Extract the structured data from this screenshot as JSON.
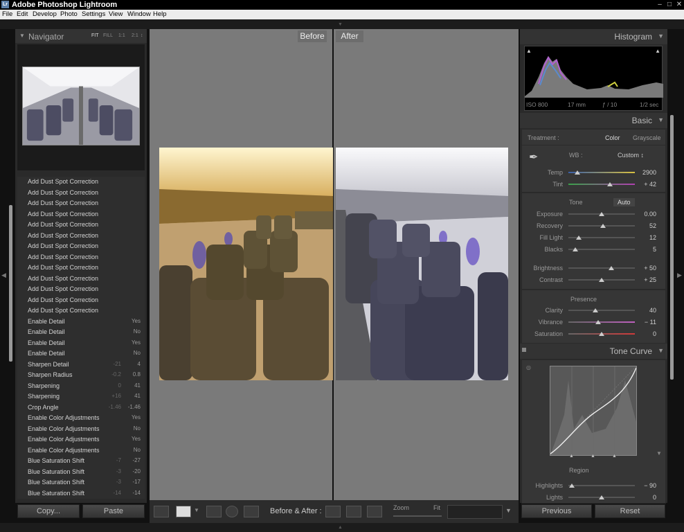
{
  "window": {
    "app_title": "Adobe Photoshop Lightroom",
    "logo": "Lr"
  },
  "menu": [
    "File",
    "Edit",
    "Develop",
    "Photo",
    "Settings",
    "View",
    "Window",
    "Help"
  ],
  "navigator": {
    "title": "Navigator",
    "zoom_options": [
      "FIT",
      "FILL",
      "1:1",
      "2:1"
    ]
  },
  "history": [
    {
      "label": "Add Dust Spot Correction",
      "before": "",
      "after": ""
    },
    {
      "label": "Add Dust Spot Correction",
      "before": "",
      "after": ""
    },
    {
      "label": "Add Dust Spot Correction",
      "before": "",
      "after": ""
    },
    {
      "label": "Add Dust Spot Correction",
      "before": "",
      "after": ""
    },
    {
      "label": "Add Dust Spot Correction",
      "before": "",
      "after": ""
    },
    {
      "label": "Add Dust Spot Correction",
      "before": "",
      "after": ""
    },
    {
      "label": "Add Dust Spot Correction",
      "before": "",
      "after": ""
    },
    {
      "label": "Add Dust Spot Correction",
      "before": "",
      "after": ""
    },
    {
      "label": "Add Dust Spot Correction",
      "before": "",
      "after": ""
    },
    {
      "label": "Add Dust Spot Correction",
      "before": "",
      "after": ""
    },
    {
      "label": "Add Dust Spot Correction",
      "before": "",
      "after": ""
    },
    {
      "label": "Add Dust Spot Correction",
      "before": "",
      "after": ""
    },
    {
      "label": "Add Dust Spot Correction",
      "before": "",
      "after": ""
    },
    {
      "label": "Enable Detail",
      "before": "",
      "after": "Yes"
    },
    {
      "label": "Enable Detail",
      "before": "",
      "after": "No"
    },
    {
      "label": "Enable Detail",
      "before": "",
      "after": "Yes"
    },
    {
      "label": "Enable Detail",
      "before": "",
      "after": "No"
    },
    {
      "label": "Sharpen Detail",
      "before": "-21",
      "after": "4"
    },
    {
      "label": "Sharpen Radius",
      "before": "-0.2",
      "after": "0.8"
    },
    {
      "label": "Sharpening",
      "before": "0",
      "after": "41"
    },
    {
      "label": "Sharpening",
      "before": "+16",
      "after": "41"
    },
    {
      "label": "Crop Angle",
      "before": "-1.46",
      "after": "-1.46"
    },
    {
      "label": "Enable Color Adjustments",
      "before": "",
      "after": "Yes"
    },
    {
      "label": "Enable Color Adjustments",
      "before": "",
      "after": "No"
    },
    {
      "label": "Enable Color Adjustments",
      "before": "",
      "after": "Yes"
    },
    {
      "label": "Enable Color Adjustments",
      "before": "",
      "after": "No"
    },
    {
      "label": "Blue Saturation Shift",
      "before": "-7",
      "after": "-27"
    },
    {
      "label": "Blue Saturation Shift",
      "before": "-3",
      "after": "-20"
    },
    {
      "label": "Blue Saturation Shift",
      "before": "-3",
      "after": "-17"
    },
    {
      "label": "Blue Saturation Shift",
      "before": "-14",
      "after": "-14"
    }
  ],
  "left_buttons": {
    "copy": "Copy...",
    "paste": "Paste"
  },
  "view": {
    "before_label": "Before",
    "after_label": "After"
  },
  "toolbar": {
    "before_after_label": "Before & After :",
    "zoom_label": "Zoom",
    "zoom_value": "Fit"
  },
  "histogram": {
    "title": "Histogram",
    "iso": "ISO 800",
    "focal": "17 mm",
    "aperture": "ƒ / 10",
    "shutter": "1/2 sec"
  },
  "basic": {
    "title": "Basic",
    "treatment_label": "Treatment :",
    "treatment_color": "Color",
    "treatment_grayscale": "Grayscale",
    "wb_label": "WB :",
    "wb_value": "Custom ↕",
    "tone_label": "Tone",
    "auto_label": "Auto",
    "presence_label": "Presence",
    "sliders": [
      {
        "key": "temp",
        "label": "Temp",
        "value": "2900",
        "position": 0.14,
        "gradient": "linear-gradient(90deg,#3a5fa8,#d8c040)"
      },
      {
        "key": "tint",
        "label": "Tint",
        "value": "+ 42",
        "position": 0.62,
        "gradient": "linear-gradient(90deg,#3aa04a,#b040b0)"
      },
      {
        "key": "exposure",
        "label": "Exposure",
        "value": "0.00",
        "position": 0.5,
        "gradient": ""
      },
      {
        "key": "recovery",
        "label": "Recovery",
        "value": "52",
        "position": 0.52,
        "gradient": ""
      },
      {
        "key": "fill_light",
        "label": "Fill Light",
        "value": "12",
        "position": 0.16,
        "gradient": ""
      },
      {
        "key": "blacks",
        "label": "Blacks",
        "value": "5",
        "position": 0.1,
        "gradient": ""
      },
      {
        "key": "brightness",
        "label": "Brightness",
        "value": "+ 50",
        "position": 0.65,
        "gradient": ""
      },
      {
        "key": "contrast",
        "label": "Contrast",
        "value": "+ 25",
        "position": 0.5,
        "gradient": ""
      },
      {
        "key": "clarity",
        "label": "Clarity",
        "value": "40",
        "position": 0.41,
        "gradient": ""
      },
      {
        "key": "vibrance",
        "label": "Vibrance",
        "value": "− 11",
        "position": 0.45,
        "gradient": "linear-gradient(90deg,#666,#c060c0)"
      },
      {
        "key": "saturation",
        "label": "Saturation",
        "value": "0",
        "position": 0.5,
        "gradient": "linear-gradient(90deg,#666,#d03a3a)"
      }
    ]
  },
  "tone_curve": {
    "title": "Tone Curve",
    "region_label": "Region",
    "sliders": [
      {
        "key": "highlights",
        "label": "Highlights",
        "value": "− 90",
        "position": 0.05
      },
      {
        "key": "lights",
        "label": "Lights",
        "value": "0",
        "position": 0.5
      }
    ]
  },
  "right_buttons": {
    "previous": "Previous",
    "reset": "Reset"
  }
}
